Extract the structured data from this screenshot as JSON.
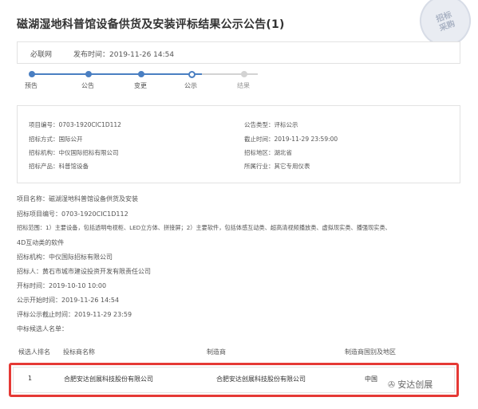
{
  "page": {
    "title": "磁湖湿地科普馆设备供货及安装评标结果公示公告(1)",
    "stamp": "招标采购"
  },
  "meta": {
    "source": "必联网",
    "publish_label": "发布时间：",
    "publish_time": "2019-11-26 14:54"
  },
  "steps": [
    {
      "label": "预告",
      "state": "done"
    },
    {
      "label": "公告",
      "state": "done"
    },
    {
      "label": "变更",
      "state": "done"
    },
    {
      "label": "公示",
      "state": "current"
    },
    {
      "label": "结果",
      "state": "todo"
    }
  ],
  "info": {
    "project_no_label": "项目编号：",
    "project_no": "0703-1920CIC1D112",
    "method_label": "招标方式：",
    "method": "国际公开",
    "agency_label": "招标机构：",
    "agency": "中仪国际招标有限公司",
    "product_label": "招标产品：",
    "product": "科普馆设备",
    "type_label": "公告类型：",
    "type": "评标公示",
    "deadline_label": "截止时间：",
    "deadline": "2019-11-29 23:59:00",
    "region_label": "招标地区：",
    "region": "湖北省",
    "industry_label": "所属行业：",
    "industry": "其它专用仪表"
  },
  "body": {
    "line1": "项目名称：磁湖湿地科普馆设备供货及安装",
    "line2": "招标项目编号：0703-1920CIC1D112",
    "line3": "招标范围：1）主要设备，包括透明电视柜、LED立方体、拼接屏；2）主要软件，包括体感互动类、超高清视频播放类、虚拟现实类、播强现实类、",
    "line4": "4D互动类的软件",
    "line5": "招标机构：中仪国际招标有限公司",
    "line6": "招标人：黄石市城市建设投资开发有限责任公司",
    "line7": "开标时间：2019-10-10 10:00",
    "line8": "公示开始时间：2019-11-26 14:54",
    "line9": "评标公示截止时间：2019-11-29 23:59",
    "line10": "中标候选人名单："
  },
  "table": {
    "headers": [
      "候选人排名",
      "投标商名称",
      "制造商",
      "制造商国别及地区"
    ],
    "rows": [
      {
        "rank": "1",
        "bidder": "合肥安达创展科技股份有限公司",
        "maker": "合肥安达创展科技股份有限公司",
        "country": "中国"
      }
    ]
  },
  "watermark": {
    "icon": "wechat-icon",
    "text": "安达创展"
  }
}
